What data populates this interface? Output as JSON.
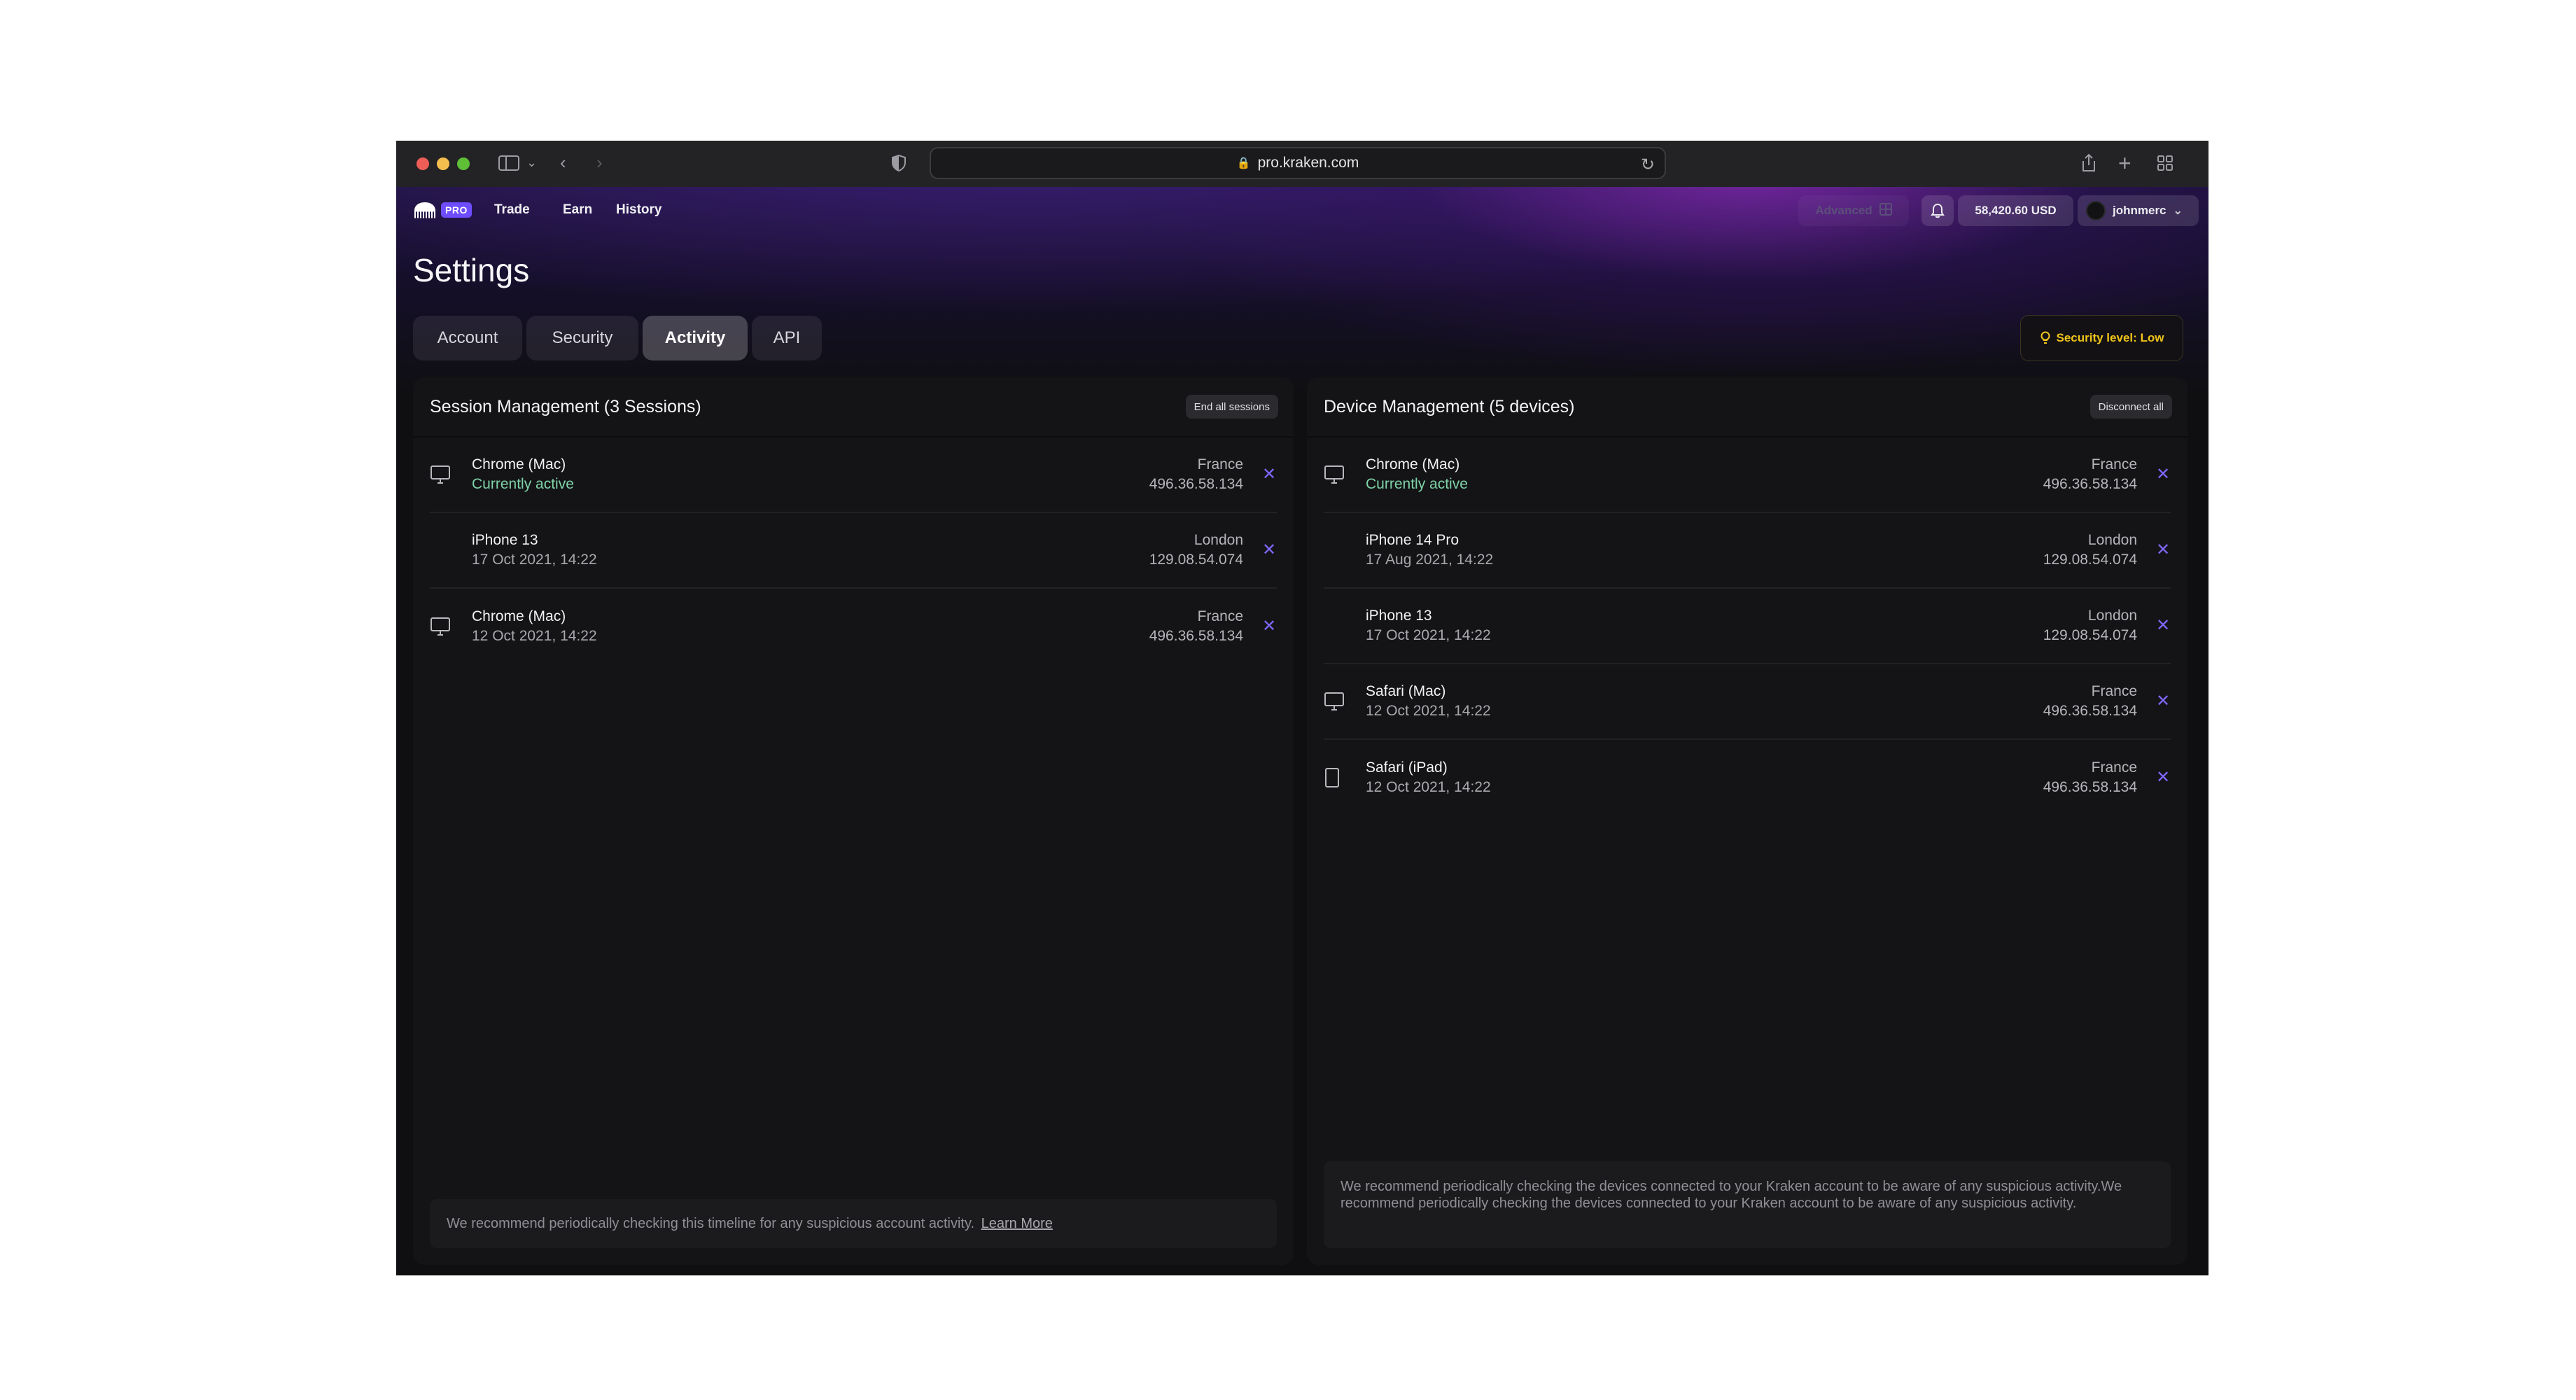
{
  "browser": {
    "url": "pro.kraken.com"
  },
  "nav": {
    "logo_badge": "PRO",
    "links": [
      "Trade",
      "Earn",
      "History"
    ],
    "advanced_label": "Advanced",
    "balance": "58,420.60 USD",
    "username": "johnmerc"
  },
  "page": {
    "title": "Settings",
    "tabs": [
      "Account",
      "Security",
      "Activity",
      "API"
    ],
    "active_tab": "Activity",
    "security_level": "Security level: Low"
  },
  "sessions": {
    "title": "Session Management (3 Sessions)",
    "action": "End all sessions",
    "rows": [
      {
        "icon": "desktop-icon",
        "name": "Chrome (Mac)",
        "sub": "Currently active",
        "country": "France",
        "ip": "496.36.58.134"
      },
      {
        "icon": "",
        "name": "iPhone 13",
        "sub": "17 Oct 2021, 14:22",
        "country": "London",
        "ip": "129.08.54.074"
      },
      {
        "icon": "desktop-icon",
        "name": "Chrome (Mac)",
        "sub": "12 Oct 2021, 14:22",
        "country": "France",
        "ip": "496.36.58.134"
      }
    ],
    "note": "We recommend periodically checking this timeline for any suspicious account activity.",
    "note_link": "Learn More"
  },
  "devices": {
    "title": "Device Management (5 devices)",
    "action": "Disconnect all",
    "rows": [
      {
        "icon": "desktop-icon",
        "name": "Chrome (Mac)",
        "sub": "Currently active",
        "country": "France",
        "ip": "496.36.58.134"
      },
      {
        "icon": "",
        "name": "iPhone 14 Pro",
        "sub": "17 Aug 2021, 14:22",
        "country": "London",
        "ip": "129.08.54.074"
      },
      {
        "icon": "",
        "name": "iPhone 13",
        "sub": "17 Oct 2021, 14:22",
        "country": "London",
        "ip": "129.08.54.074"
      },
      {
        "icon": "desktop-icon",
        "name": "Safari (Mac)",
        "sub": "12 Oct 2021, 14:22",
        "country": "France",
        "ip": "496.36.58.134"
      },
      {
        "icon": "tablet-icon",
        "name": "Safari (iPad)",
        "sub": "12 Oct 2021, 14:22",
        "country": "France",
        "ip": "496.36.58.134"
      }
    ],
    "note": "We recommend periodically checking the devices connected to your Kraken account to be aware of any suspicious activity.We recommend periodically checking the devices connected to your Kraken account to be aware of any suspicious activity."
  },
  "colors": {
    "accent": "#8068ff",
    "active_green": "#7fd3a8",
    "warning_yellow": "#f0c419"
  }
}
